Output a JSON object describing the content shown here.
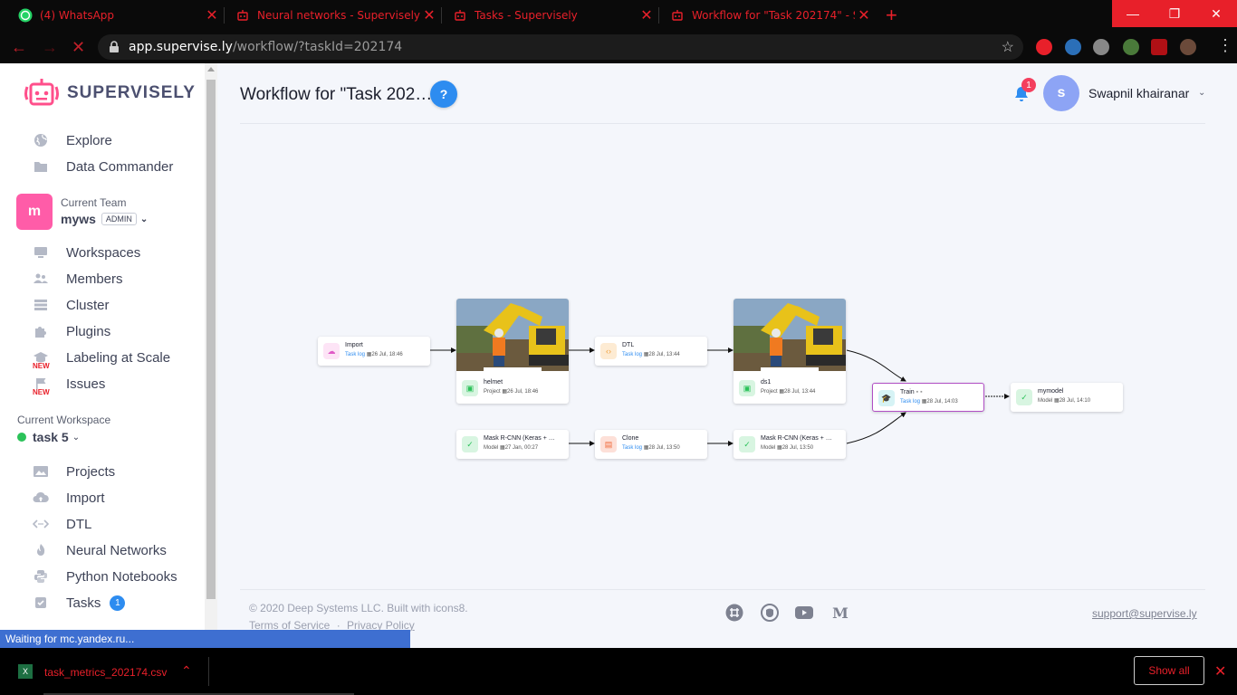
{
  "browser": {
    "tabs": [
      {
        "title": "(4) WhatsApp",
        "icon": "whatsapp-icon"
      },
      {
        "title": "Neural networks - Supervisely",
        "icon": "supervisely-icon"
      },
      {
        "title": "Tasks - Supervisely",
        "icon": "supervisely-icon"
      },
      {
        "title": "Workflow for \"Task 202174\" - Supervisely",
        "icon": "supervisely-icon",
        "active": true
      }
    ],
    "url_host": "app.supervise.ly",
    "url_path": "/workflow/?taskId=202174",
    "accent_color": "#e8202a"
  },
  "sidebar": {
    "logo_text": "SUPERVISELY",
    "top_items": [
      {
        "label": "Explore",
        "icon": "globe-icon"
      },
      {
        "label": "Data Commander",
        "icon": "folder-icon"
      }
    ],
    "team": {
      "caption": "Current Team",
      "avatar_letter": "m",
      "name": "myws",
      "role": "ADMIN"
    },
    "team_items": [
      {
        "label": "Workspaces",
        "icon": "monitor-icon"
      },
      {
        "label": "Members",
        "icon": "users-icon"
      },
      {
        "label": "Cluster",
        "icon": "server-icon"
      },
      {
        "label": "Plugins",
        "icon": "puzzle-icon"
      },
      {
        "label": "Labeling at Scale",
        "icon": "graduation-cap-icon",
        "badge": "NEW"
      },
      {
        "label": "Issues",
        "icon": "flag-icon",
        "badge": "NEW"
      }
    ],
    "workspace": {
      "caption": "Current Workspace",
      "name": "task 5"
    },
    "workspace_items": [
      {
        "label": "Projects",
        "icon": "images-icon"
      },
      {
        "label": "Import",
        "icon": "cloud-upload-icon"
      },
      {
        "label": "DTL",
        "icon": "code-icon"
      },
      {
        "label": "Neural Networks",
        "icon": "flame-icon"
      },
      {
        "label": "Python Notebooks",
        "icon": "python-icon"
      },
      {
        "label": "Tasks",
        "icon": "checkbox-icon",
        "count": "1"
      }
    ]
  },
  "header": {
    "title": "Workflow for \"Task 202…",
    "help": "?",
    "notifications": "1",
    "user_initial": "s",
    "user_name": "Swapnil khairanar"
  },
  "workflow": {
    "nodes": {
      "import": {
        "title": "Import",
        "link": "Task log",
        "date": "26 Jul, 18:46"
      },
      "helmet": {
        "title": "helmet",
        "kind": "Project",
        "date": "26 Jul, 18:46"
      },
      "dtl": {
        "title": "DTL",
        "link": "Task log",
        "date": "28 Jul, 13:44"
      },
      "ds1": {
        "title": "ds1",
        "kind": "Project",
        "date": "28 Jul, 13:44"
      },
      "mask1": {
        "title": "Mask R-CNN (Keras + …",
        "kind": "Model",
        "date": "27 Jan, 00:27"
      },
      "clone": {
        "title": "Clone",
        "link": "Task log",
        "date": "28 Jul, 13:50"
      },
      "mask2": {
        "title": "Mask R-CNN (Keras + …",
        "kind": "Model",
        "date": "28 Jul, 13:50"
      },
      "train": {
        "title": "Train",
        "link": "Task log",
        "date": "28 Jul, 14:03"
      },
      "mymodel": {
        "title": "mymodel",
        "kind": "Model",
        "date": "28 Jul, 14:10"
      }
    }
  },
  "footer": {
    "copyright": "© 2020 Deep Systems LLC. Built with icons8.",
    "terms": "Terms of Service",
    "sep": "·",
    "privacy": "Privacy Policy",
    "support": "support@supervise.ly"
  },
  "status": {
    "text": "Waiting for mc.yandex.ru..."
  },
  "download": {
    "filename": "task_metrics_202174.csv",
    "show_all": "Show all"
  }
}
